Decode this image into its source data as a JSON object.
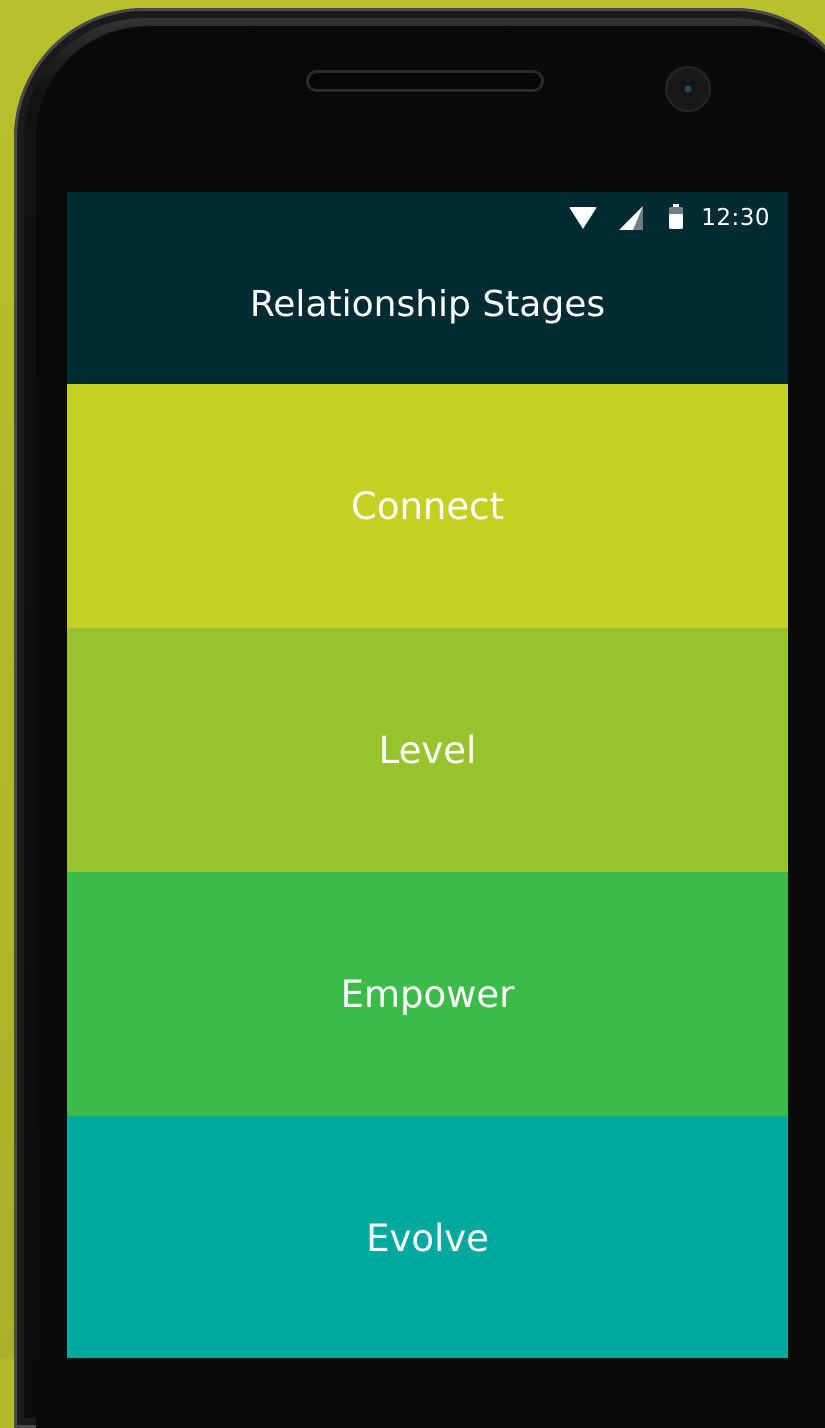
{
  "status_bar": {
    "time": "12:30",
    "icons": [
      "wifi-icon",
      "signal-icon",
      "battery-icon"
    ]
  },
  "app_bar": {
    "title": "Relationship Stages"
  },
  "stages": [
    {
      "label": "Connect",
      "color": "#c4d024"
    },
    {
      "label": "Level",
      "color": "#98c22e"
    },
    {
      "label": "Empower",
      "color": "#3dbb48"
    },
    {
      "label": "Evolve",
      "color": "#00a99d"
    }
  ],
  "colors": {
    "app_bar": "#002b33",
    "background": "#b2ba2a"
  }
}
